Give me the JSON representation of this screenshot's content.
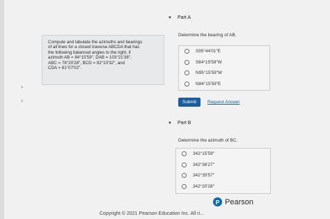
{
  "nav": {
    "arrow_1": "›",
    "arrow_2": "›"
  },
  "problem": {
    "line_1": "Compute and tabulate the azimuths and bearings",
    "line_2": "of all lines for a closed traverse ABCDA that has",
    "line_3": "the following balanced angles to the right, if",
    "line_4": "azimuth AB = 84°15′59″, DAB = 103°21′38″,",
    "line_5": "ABC = 78°20′28″, BCD = 92°10′32″, and",
    "line_6": "CDA = 81°07′02″."
  },
  "part_a": {
    "title": "Part A",
    "question": "Determine the bearing of AB.",
    "options": [
      "S95°44′01″E",
      "S84°15′59″W",
      "N95°15′59″W",
      "N84°15′59″E"
    ]
  },
  "actions": {
    "submit_label": "Submit",
    "request_label": "Request Answer"
  },
  "part_b": {
    "title": "Part B",
    "question": "Determine the azimuth of BC.",
    "options": [
      "342°15′59″",
      "342°36′27″",
      "342°35′57″",
      "342°20′28″"
    ]
  },
  "brand": {
    "logo_letter": "P",
    "logo_name": "Pearson",
    "color": "#0b6bb0"
  },
  "footer": {
    "copyright": "Copyright © 2021 Pearson Education Inc. All ri..."
  }
}
